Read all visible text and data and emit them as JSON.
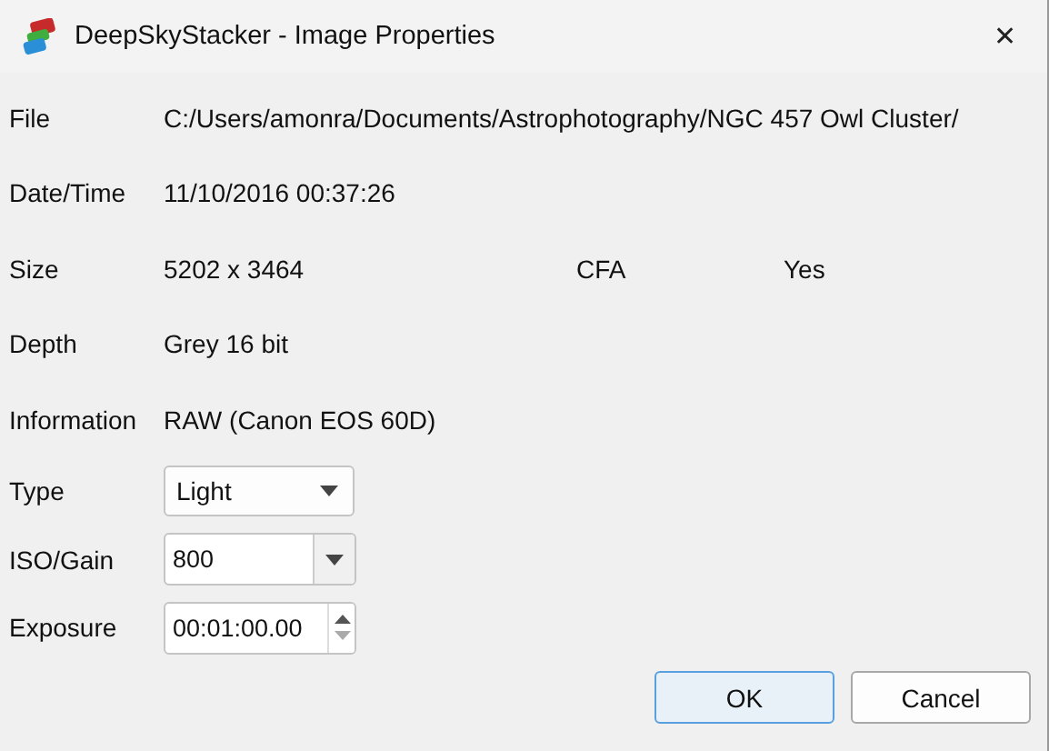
{
  "window": {
    "title": "DeepSkyStacker - Image Properties",
    "close": "✕"
  },
  "properties": [
    {
      "label": "File",
      "value": "C:/Users/amonra/Documents/Astrophotography/NGC 457 Owl Cluster/"
    },
    {
      "label": "Date/Time",
      "value": "11/10/2016 00:37:26"
    },
    {
      "label": "Size",
      "value": "5202 x 3464",
      "extra_label": "CFA",
      "extra_value": "Yes"
    },
    {
      "label": "Depth",
      "value": "Grey 16 bit"
    },
    {
      "label": "Information",
      "value": "RAW (Canon EOS 60D)"
    }
  ],
  "fields": [
    {
      "label": "Type",
      "kind": "dropdown",
      "value": "Light"
    },
    {
      "label": "ISO/Gain",
      "kind": "combo",
      "value": "800"
    },
    {
      "label": "Exposure",
      "kind": "spin",
      "value": "00:01:00.00"
    }
  ],
  "buttons": [
    {
      "label": "OK",
      "default": true
    },
    {
      "label": "Cancel",
      "default": false
    }
  ]
}
